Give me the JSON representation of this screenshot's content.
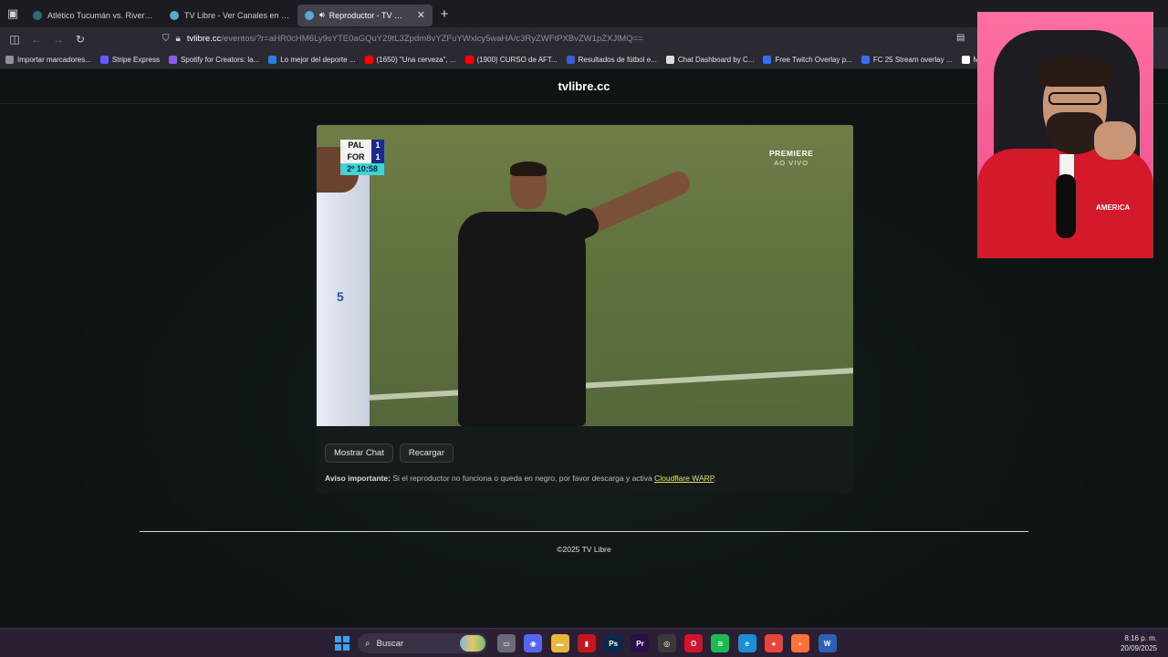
{
  "browser": {
    "tabs": [
      {
        "title": "Atlético Tucumán vs. River Plate |",
        "favicon_color": "#2d6a7a"
      },
      {
        "title": "TV Libre - Ver Canales en VIVO Or",
        "favicon_color": "#5aaad0"
      },
      {
        "title": "Reproductor - TV Libre",
        "favicon_color": "#5aaad0",
        "active": true
      }
    ],
    "url_host": "tvlibre.cc",
    "url_path": "/eventos/?r=aHR0cHM6Ly9sYTE0aGQuY29tL3Zpdm8vYZFuYWxlcy5waHA/c3RyZWFtPXBvZW1pZXJlMQ==",
    "bookmarks": [
      {
        "label": "Importar marcadores...",
        "color": "#8f8f9d"
      },
      {
        "label": "Stripe Express",
        "color": "#635bff"
      },
      {
        "label": "Spotify for Creators: la...",
        "color": "#8a5cf5"
      },
      {
        "label": "Lo mejor del deporte ...",
        "color": "#2d7be0"
      },
      {
        "label": "(1650) \"Una cerveza\", ...",
        "color": "#ff0000"
      },
      {
        "label": "(1900) CURSO de AFT...",
        "color": "#ff0000"
      },
      {
        "label": "Resultados de fútbol e...",
        "color": "#3a5bd9"
      },
      {
        "label": "Chat Dashboard by C...",
        "color": "#dddddd"
      },
      {
        "label": "Free Twitch Overlay p...",
        "color": "#3a6ee8"
      },
      {
        "label": "FC 25 Stream overlay ...",
        "color": "#3a6ee8"
      },
      {
        "label": "Make y",
        "color": "#ffffff"
      }
    ]
  },
  "site": {
    "logo": "tvlibre.cc",
    "scorebug": {
      "team1": "PAL",
      "score1": "1",
      "team2": "FOR",
      "score2": "1",
      "time": "2º 10:58"
    },
    "premiere_line1": "PREMIERE",
    "premiere_line2": "AO VIVO",
    "jersey_number": "5",
    "btn_chat": "Mostrar Chat",
    "btn_reload": "Recargar",
    "notice_bold": "Aviso importante:",
    "notice_text": " Si el reproductor no funciona o queda en negro, por favor descarga y activa ",
    "notice_link": "Cloudflare WARP",
    "notice_end": ".",
    "footer": "©2025 TV Libre"
  },
  "webcam": {
    "shirt_text": "AMERICA"
  },
  "taskbar": {
    "search_label": "Buscar",
    "apps": [
      {
        "name": "file-manager",
        "glyph": "▭",
        "color": "#6a6a7a"
      },
      {
        "name": "discord",
        "glyph": "◉",
        "color": "#5865f2"
      },
      {
        "name": "folder",
        "glyph": "▬",
        "color": "#e8b73a"
      },
      {
        "name": "pdf",
        "glyph": "▮",
        "color": "#c4161c"
      },
      {
        "name": "photoshop",
        "glyph": "Ps",
        "color": "#0b2a4a"
      },
      {
        "name": "premiere",
        "glyph": "Pr",
        "color": "#2a0f4a"
      },
      {
        "name": "obs",
        "glyph": "◎",
        "color": "#3a3a3a"
      },
      {
        "name": "opera",
        "glyph": "O",
        "color": "#d0142c"
      },
      {
        "name": "spotify",
        "glyph": "≋",
        "color": "#1db954"
      },
      {
        "name": "edge",
        "glyph": "e",
        "color": "#1a8fd6"
      },
      {
        "name": "chrome",
        "glyph": "●",
        "color": "#e8453c"
      },
      {
        "name": "firefox",
        "glyph": "◐",
        "color": "#ff7139"
      },
      {
        "name": "word",
        "glyph": "W",
        "color": "#2b5fb8"
      }
    ],
    "time": "8:16 p. m.",
    "date": "20/09/2025"
  }
}
